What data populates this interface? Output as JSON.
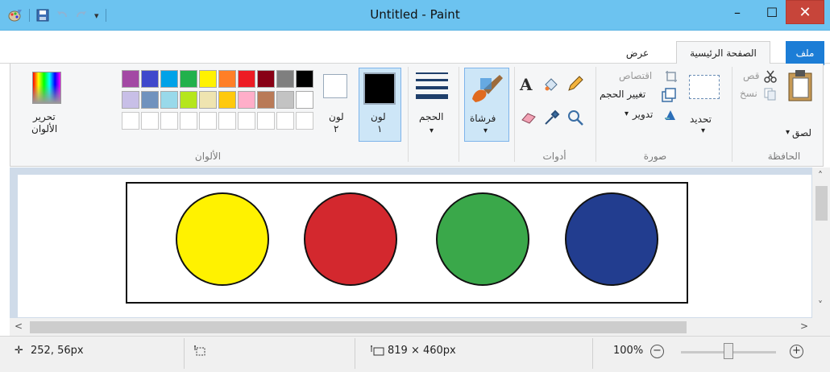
{
  "window": {
    "title": "Untitled - Paint",
    "minimize": "–",
    "maximize": "☐",
    "close": "✕"
  },
  "qat": {
    "customize": "▾"
  },
  "tabs": {
    "file": "ملف",
    "home": "الصفحة الرئيسية",
    "view": "عرض"
  },
  "clipboard": {
    "paste": "لصق",
    "paste_arrow": "▾",
    "cut": "قص",
    "copy": "نسخ",
    "group": "الحافظة"
  },
  "image": {
    "select": "تحديد",
    "select_arrow": "▾",
    "crop": "اقتصاص",
    "resize": "تغيير الحجم",
    "rotate": "تدوير",
    "rotate_arrow": "▾",
    "group": "صورة"
  },
  "tools": {
    "text_glyph": "A",
    "group": "أدوات"
  },
  "brushes": {
    "label": "فرشاة",
    "arrow": "▾"
  },
  "size": {
    "label": "الحجم",
    "arrow": "▾"
  },
  "colors": {
    "color1": {
      "label": "لون",
      "number": "١",
      "value": "#000000"
    },
    "color2": {
      "label": "لون",
      "number": "٢",
      "value": "#ffffff"
    },
    "edit_line1": "تحرير",
    "edit_line2": "الألوان",
    "group": "الألوان",
    "palette_row1": [
      "#000000",
      "#7f7f7f",
      "#880015",
      "#ed1c24",
      "#ff7f27",
      "#fff200",
      "#22b14c",
      "#00a2e8",
      "#3f48cc",
      "#a349a4"
    ],
    "palette_row2": [
      "#ffffff",
      "#c3c3c3",
      "#b97a57",
      "#ffaec9",
      "#ffc90e",
      "#efe4b0",
      "#b5e61d",
      "#99d9ea",
      "#7092be",
      "#c8bfe7"
    ]
  },
  "canvas": {
    "circles": [
      "#fff200",
      "#d3282e",
      "#3aa84a",
      "#223d8f"
    ]
  },
  "status": {
    "cursor_pos": "252, 56px",
    "selection_size": "",
    "image_size": "819 × 460px",
    "zoom": "100%",
    "zoom_out": "−",
    "zoom_in": "+",
    "zoom_level": 0.5
  }
}
